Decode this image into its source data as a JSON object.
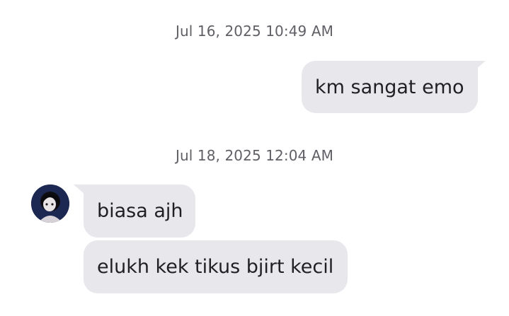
{
  "conversation": {
    "timestamps": [
      "Jul 16, 2025 10:49 AM",
      "Jul 18, 2025 12:04 AM"
    ],
    "messages": [
      {
        "direction": "outgoing",
        "text": "km sangat emo"
      },
      {
        "direction": "incoming",
        "text": "biasa ajh"
      },
      {
        "direction": "incoming",
        "text": "elukh kek tikus bjirt kecil"
      }
    ],
    "contact_avatar_icon": "avatar-icon"
  },
  "colors": {
    "bubble_bg": "#e7e7ec",
    "bubble_text": "#1f1f24",
    "timestamp_text": "#5f5f66",
    "background": "#ffffff"
  }
}
